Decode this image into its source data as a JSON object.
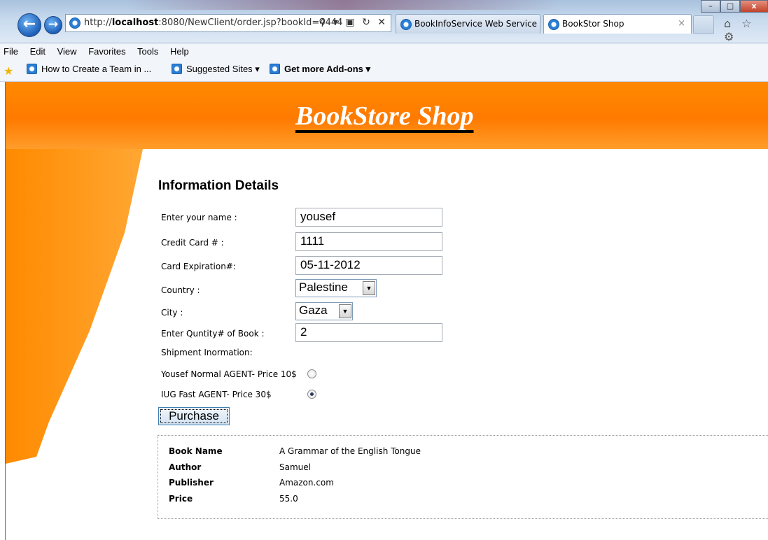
{
  "browser": {
    "address": {
      "prefix": "http://",
      "host": "localhost",
      "rest": ":8080/NewClient/order.jsp?bookId=4444",
      "tools": "⚲ ▾ ▣ ↻ ✕"
    },
    "tabs": [
      {
        "label": "BookInfoService Web Service"
      },
      {
        "label": "BookStor Shop",
        "close": "×"
      }
    ],
    "right_tools": "⌂ ☆ ⚙",
    "window_controls": {
      "min": "–",
      "max": "□",
      "close": "x"
    },
    "menu": [
      "File",
      "Edit",
      "View",
      "Favorites",
      "Tools",
      "Help"
    ],
    "favorites": [
      {
        "label": "How to Create a Team in ..."
      },
      {
        "label": "Suggested Sites ▾"
      },
      {
        "label": "Get more Add-ons ▾"
      }
    ]
  },
  "page": {
    "site_title": "BookStore Shop",
    "section_title": "Information Details",
    "form": {
      "name_label": "Enter your name :",
      "name_value": "yousef",
      "cc_label": "Credit Card # :",
      "cc_value": "1111",
      "exp_label": "Card Expiration#:",
      "exp_value": "05-11-2012",
      "country_label": "Country :",
      "country_value": "Palestine",
      "city_label": "City :",
      "city_value": "Gaza",
      "qty_label": "Enter Quntity# of Book :",
      "qty_value": "2",
      "shipment_label": "Shipment Inormation:",
      "agent1_label": "Yousef Normal AGENT- Price 10$",
      "agent1_selected": false,
      "agent2_label": "IUG Fast AGENT- Price 30$",
      "agent2_selected": true,
      "purchase_label": "Purchase"
    },
    "book": {
      "name_key": "Book Name",
      "name_value": "A Grammar of the English Tongue",
      "author_key": "Author",
      "author_value": "Samuel",
      "publisher_key": "Publisher",
      "publisher_value": "Amazon.com",
      "price_key": "Price",
      "price_value": "55.0"
    }
  },
  "colors": {
    "orange": "#ff8000",
    "chrome_blue": "#c8daee"
  }
}
